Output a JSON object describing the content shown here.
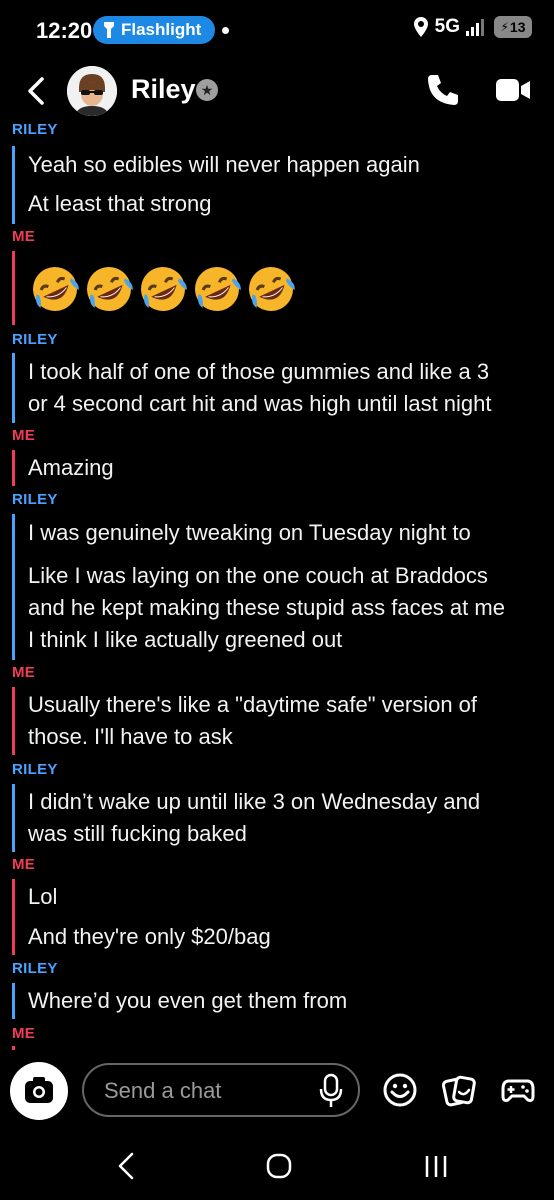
{
  "status_bar": {
    "time": "12:20",
    "flashlight_label": "Flashlight",
    "network": "5G",
    "battery": "13"
  },
  "header": {
    "contact_name": "Riley"
  },
  "colors": {
    "riley": "#4aa3ff",
    "me": "#f23c57",
    "accent_blue": "#1e88e5"
  },
  "messages": {
    "s1": "RILEY",
    "m1": "Yeah so edibles will never happen again",
    "m2": "At least that strong",
    "s2": "ME",
    "emoji_count": 5,
    "s3": "RILEY",
    "m3a": "I took half of one of those gummies and like a 3",
    "m3b": "or 4 second cart hit and was high until last night",
    "s4": "ME",
    "m4": "Amazing",
    "s5": "RILEY",
    "m5": "I was genuinely tweaking on Tuesday night to",
    "m6a": "Like I was laying on the one couch at Braddocs",
    "m6b": "and he kept making these stupid ass faces at me",
    "m7": "I think I like actually greened out",
    "s6": "ME",
    "m8a": "Usually there's like a \"daytime safe\" version of",
    "m8b": "those. I'll have to ask",
    "s7": "RILEY",
    "m9a": "I didn’t wake up until like 3 on Wednesday and",
    "m9b": "was still fucking baked",
    "s8": "ME",
    "m10": "Lol",
    "m11": "And they're only $20/bag",
    "s9": "RILEY",
    "m12": "Where’d you even get them from",
    "s10": "ME"
  },
  "composer": {
    "placeholder": "Send a chat"
  },
  "icons": [
    "back-icon",
    "avatar",
    "verified-icon",
    "phone-icon",
    "video-icon",
    "camera-icon",
    "mic-icon",
    "smiley-icon",
    "stickers-icon",
    "games-icon",
    "nav-back-icon",
    "nav-home-icon",
    "nav-recents-icon",
    "flashlight-icon",
    "location-icon",
    "signal-icon"
  ]
}
